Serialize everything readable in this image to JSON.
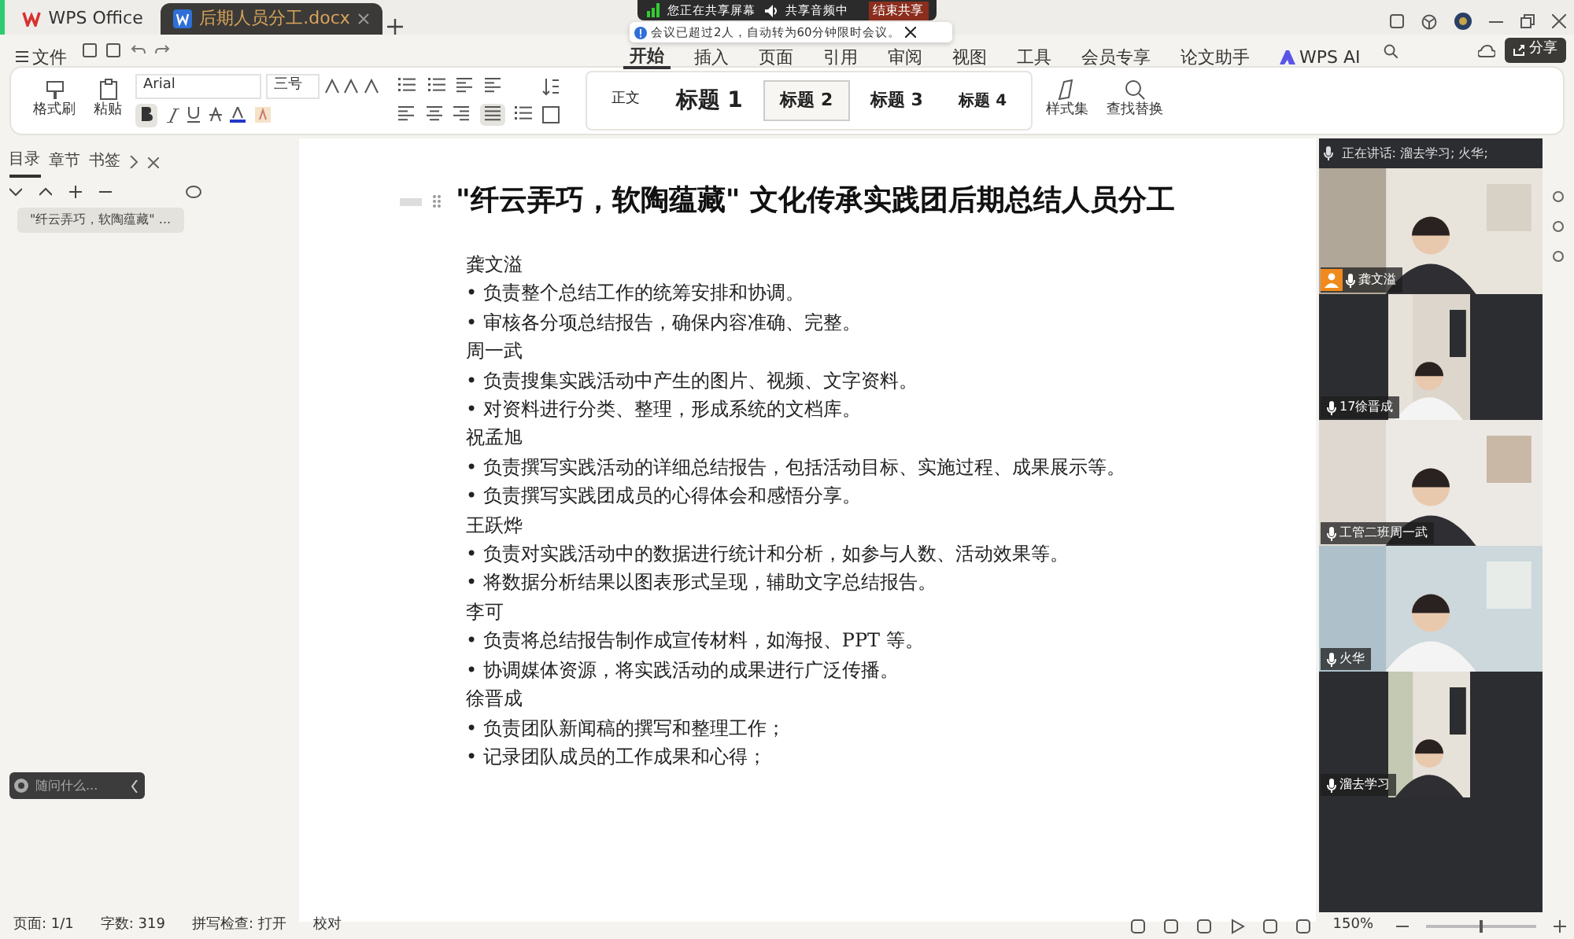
{
  "app_tabs": [
    {
      "label": "WPS Office",
      "kind": "home",
      "selected": false
    },
    {
      "label": "后期人员分工.docx",
      "kind": "doc",
      "selected": true
    }
  ],
  "share_banner": {
    "status": "您正在共享屏幕",
    "audio": "共享音频中",
    "stop": "结束共享",
    "notice": "会议已超过2人，自动转为60分钟限时会议。"
  },
  "file_menu": "文件",
  "ribbon_tabs": [
    {
      "label": "开始",
      "kind": "text",
      "selected": true
    },
    {
      "label": "插入",
      "kind": "text",
      "selected": false
    },
    {
      "label": "页面",
      "kind": "text",
      "selected": false
    },
    {
      "label": "引用",
      "kind": "text",
      "selected": false
    },
    {
      "label": "审阅",
      "kind": "text",
      "selected": false
    },
    {
      "label": "视图",
      "kind": "text",
      "selected": false
    },
    {
      "label": "工具",
      "kind": "text",
      "selected": false
    },
    {
      "label": "会员专享",
      "kind": "text",
      "selected": false
    },
    {
      "label": "论文助手",
      "kind": "text",
      "selected": false
    },
    {
      "label": "WPS AI",
      "kind": "ai",
      "selected": false
    }
  ],
  "share_button": "分享",
  "ribbon": {
    "format_painter": "格式刷",
    "paste": "粘贴",
    "font": "Arial",
    "size": "三号",
    "bold": true,
    "justify": true,
    "styles": [
      {
        "label": "正文",
        "selected": false
      },
      {
        "label": "标题 1",
        "selected": false
      },
      {
        "label": "标题 2",
        "selected": true
      },
      {
        "label": "标题 3",
        "selected": false
      },
      {
        "label": "标题 4",
        "selected": false
      }
    ],
    "style_set": "样式集",
    "find_replace": "查找替换"
  },
  "sidebar": {
    "tabs": [
      {
        "label": "目录",
        "selected": true
      },
      {
        "label": "章节",
        "selected": false
      },
      {
        "label": "书签",
        "selected": false
      }
    ],
    "outline": [
      {
        "label": "\"纤云弄巧，软陶蕴藏\" ...",
        "selected": true
      }
    ]
  },
  "chat_input": {
    "placeholder": "随问什么..."
  },
  "document": {
    "title": "\"纤云弄巧，软陶蕴藏\" 文化传承实践团后期总结人员分工",
    "sections": [
      {
        "name": "龚文溢",
        "items": [
          "• 负责整个总结工作的统筹安排和协调。",
          "• 审核各分项总结报告，确保内容准确、完整。"
        ]
      },
      {
        "name": "周一武",
        "items": [
          "• 负责搜集实践活动中产生的图片、视频、文字资料。",
          "• 对资料进行分类、整理，形成系统的文档库。"
        ]
      },
      {
        "name": "祝孟旭",
        "items": [
          "• 负责撰写实践活动的详细总结报告，包括活动目标、实施过程、成果展示等。",
          "• 负责撰写实践团成员的心得体会和感悟分享。"
        ]
      },
      {
        "name": "王跃烨",
        "items": [
          "• 负责对实践活动中的数据进行统计和分析，如参与人数、活动效果等。",
          "• 将数据分析结果以图表形式呈现，辅助文字总结报告。"
        ]
      },
      {
        "name": "李可",
        "items": [
          "• 负责将总结报告制作成宣传材料，如海报、PPT 等。",
          "• 协调媒体资源，将实践活动的成果进行广泛传播。"
        ]
      },
      {
        "name": "徐晋成",
        "items": [
          "• 负责团队新闻稿的撰写和整理工作；",
          "• 记录团队成员的工作成果和心得；"
        ]
      }
    ]
  },
  "meeting": {
    "speaking": "正在讲话: 溜去学习; 火华;",
    "participants": [
      {
        "name": "龚文溢",
        "host": true,
        "kind": "wide"
      },
      {
        "name": "17徐晋成",
        "host": false,
        "kind": "narrow"
      },
      {
        "name": "工管二班周一武",
        "host": false,
        "kind": "wide"
      },
      {
        "name": "火华",
        "host": false,
        "kind": "wide"
      },
      {
        "name": "溜去学习",
        "host": false,
        "kind": "narrow"
      }
    ]
  },
  "status_bar": {
    "items": [
      "页面: 1/1",
      "字数: 319",
      "拼写检查: 打开",
      "校对"
    ],
    "zoom": "150%",
    "zoom_slider": {
      "level": 0.5
    }
  }
}
